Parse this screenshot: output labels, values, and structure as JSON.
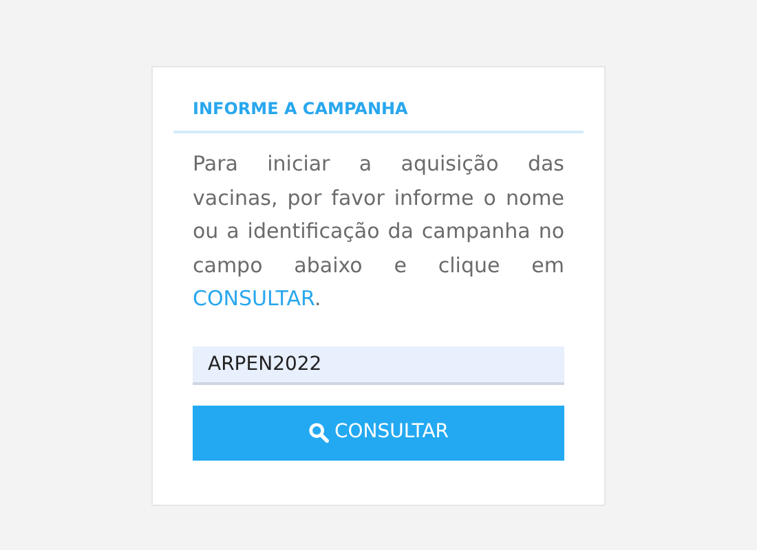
{
  "card": {
    "title": "INFORME A CAMPANHA",
    "instructions": {
      "text": "Para iniciar a aquisição das vacinas, por favor informe o nome ou a identificação da campanha no campo abaixo e clique em",
      "link": "CONSULTAR",
      "end": "."
    },
    "campaign_field": {
      "value": "ARPEN2022"
    },
    "submit_button": {
      "label": "CONSULTAR"
    }
  }
}
